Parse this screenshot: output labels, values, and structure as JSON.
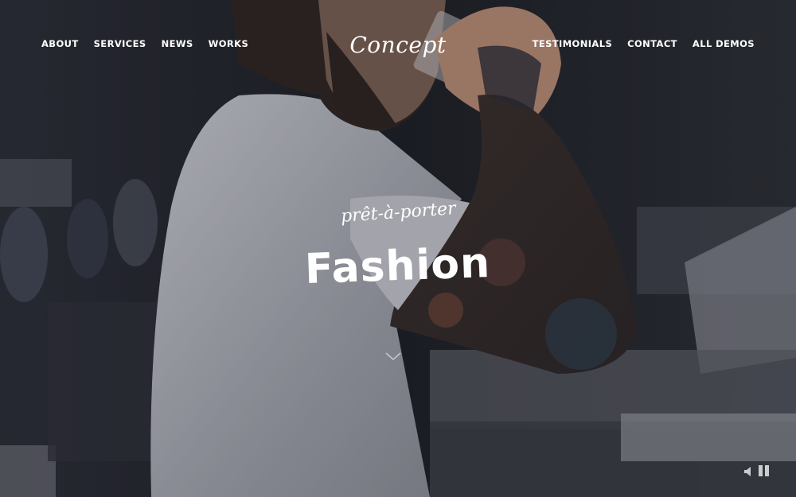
{
  "nav": {
    "left": [
      "ABOUT",
      "SERVICES",
      "NEWS",
      "WORKS"
    ],
    "right": [
      "TESTIMONIALS",
      "CONTACT",
      "ALL DEMOS"
    ]
  },
  "logo": "Concept",
  "hero": {
    "tagline": "prêt-à-porter",
    "headline": "Fashion"
  },
  "icons": {
    "scroll": "chevron-down-icon",
    "volume": "volume-icon",
    "pause": "pause-icon"
  },
  "colors": {
    "text": "#ffffff",
    "background": "#1e1f24"
  }
}
